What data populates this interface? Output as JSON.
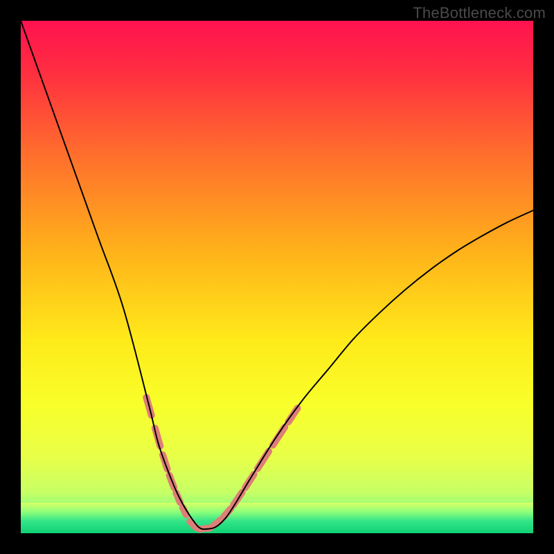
{
  "watermark": "TheBottleneck.com",
  "chart_data": {
    "type": "line",
    "title": "",
    "xlabel": "",
    "ylabel": "",
    "xlim": [
      0,
      100
    ],
    "ylim": [
      0,
      100
    ],
    "x": [
      0,
      5,
      10,
      15,
      20,
      25,
      27,
      30,
      32,
      34,
      35,
      36,
      38,
      40,
      42,
      45,
      50,
      55,
      60,
      65,
      70,
      75,
      80,
      85,
      90,
      95,
      100
    ],
    "values": [
      100,
      86,
      72,
      58,
      44,
      25,
      17,
      9,
      5,
      2,
      1,
      0.8,
      1.2,
      3,
      6,
      11,
      19,
      26,
      32,
      38,
      43,
      47.5,
      51.5,
      55,
      58,
      60.7,
      63
    ],
    "series": [
      {
        "name": "bottleneck-curve",
        "x": [
          0,
          5,
          10,
          15,
          20,
          25,
          27,
          30,
          32,
          34,
          35,
          36,
          38,
          40,
          42,
          45,
          50,
          55,
          60,
          65,
          70,
          75,
          80,
          85,
          90,
          95,
          100
        ],
        "values": [
          100,
          86,
          72,
          58,
          44,
          25,
          17,
          9,
          5,
          2,
          1,
          0.8,
          1.2,
          3,
          6,
          11,
          19,
          26,
          32,
          38,
          43,
          47.5,
          51.5,
          55,
          58,
          60.7,
          63
        ],
        "color": "#000000",
        "stroke_width": 2
      },
      {
        "name": "highlight-dashes-left",
        "x": [
          24.5,
          25.5,
          26.2,
          27.2,
          27.7,
          28.6,
          29.0,
          29.9,
          30.3,
          31.1,
          31.6,
          32.3
        ],
        "values": [
          26.5,
          23.0,
          20.5,
          17.0,
          15.3,
          12.5,
          11.3,
          8.9,
          7.9,
          6.0,
          5.0,
          3.6
        ],
        "style": "segments-pairs",
        "color": "#de7f77",
        "stroke_width": 10
      },
      {
        "name": "highlight-dashes-bottom",
        "x": [
          33.0,
          34.3,
          35.0,
          36.9,
          37.6,
          39.0,
          39.6,
          41.0
        ],
        "values": [
          2.3,
          1.0,
          0.8,
          1.0,
          1.5,
          2.6,
          3.2,
          4.8
        ],
        "style": "segments-pairs",
        "color": "#de7f77",
        "stroke_width": 10
      },
      {
        "name": "highlight-dashes-right",
        "x": [
          41.5,
          43.2,
          43.8,
          45.5,
          46.2,
          48.4,
          49.2,
          51.5,
          52.2,
          54.0
        ],
        "values": [
          5.5,
          8.0,
          8.9,
          11.5,
          12.6,
          16.0,
          17.2,
          20.7,
          21.7,
          24.4
        ],
        "style": "segments-pairs",
        "color": "#de7f77",
        "stroke_width": 10
      }
    ],
    "gradient": {
      "stops": [
        {
          "pos": 0.0,
          "color": "#ff1250"
        },
        {
          "pos": 0.1,
          "color": "#ff2e40"
        },
        {
          "pos": 0.25,
          "color": "#ff6a2e"
        },
        {
          "pos": 0.45,
          "color": "#ffb21a"
        },
        {
          "pos": 0.62,
          "color": "#ffe91a"
        },
        {
          "pos": 0.75,
          "color": "#f8ff2a"
        },
        {
          "pos": 0.85,
          "color": "#e8ff48"
        },
        {
          "pos": 0.92,
          "color": "#c7ff65"
        },
        {
          "pos": 0.955,
          "color": "#8bff7d"
        },
        {
          "pos": 0.975,
          "color": "#34e489"
        },
        {
          "pos": 1.0,
          "color": "#0fd477"
        }
      ]
    },
    "green_band": {
      "from_y": 0,
      "to_y": 6,
      "stops": [
        {
          "pos": 0.0,
          "color": "#d8ff66"
        },
        {
          "pos": 0.3,
          "color": "#8dff7a"
        },
        {
          "pos": 0.6,
          "color": "#34e489"
        },
        {
          "pos": 1.0,
          "color": "#0fd276"
        }
      ]
    },
    "min_point": {
      "x": 36,
      "y": 0.8
    }
  }
}
